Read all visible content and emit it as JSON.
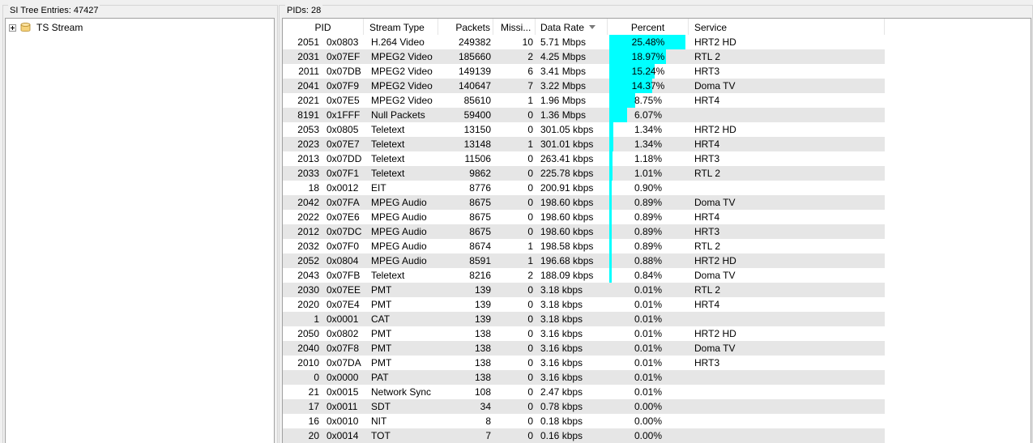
{
  "left_panel": {
    "title": "SI Tree Entries: 47427",
    "tree_root": "TS Stream"
  },
  "right_panel": {
    "title": "PIDs: 28"
  },
  "columns": {
    "pid": "PID",
    "type": "Stream Type",
    "packets": "Packets",
    "missing": "Missi...",
    "rate": "Data Rate",
    "percent": "Percent",
    "service": "Service"
  },
  "colors": {
    "bar": "#00ffff",
    "alt_row": "#e6e6e6"
  },
  "rows": [
    {
      "dec": "2051",
      "hex": "0x0803",
      "type": "H.264 Video",
      "packets": "249382",
      "missing": "10",
      "rate": "5.71 Mbps",
      "percent": "25.48%",
      "pct_value": 25.48,
      "service": "HRT2 HD"
    },
    {
      "dec": "2031",
      "hex": "0x07EF",
      "type": "MPEG2 Video",
      "packets": "185660",
      "missing": "2",
      "rate": "4.25 Mbps",
      "percent": "18.97%",
      "pct_value": 18.97,
      "service": "RTL 2"
    },
    {
      "dec": "2011",
      "hex": "0x07DB",
      "type": "MPEG2 Video",
      "packets": "149139",
      "missing": "6",
      "rate": "3.41 Mbps",
      "percent": "15.24%",
      "pct_value": 15.24,
      "service": "HRT3"
    },
    {
      "dec": "2041",
      "hex": "0x07F9",
      "type": "MPEG2 Video",
      "packets": "140647",
      "missing": "7",
      "rate": "3.22 Mbps",
      "percent": "14.37%",
      "pct_value": 14.37,
      "service": "Doma TV"
    },
    {
      "dec": "2021",
      "hex": "0x07E5",
      "type": "MPEG2 Video",
      "packets": "85610",
      "missing": "1",
      "rate": "1.96 Mbps",
      "percent": "8.75%",
      "pct_value": 8.75,
      "service": "HRT4"
    },
    {
      "dec": "8191",
      "hex": "0x1FFF",
      "type": "Null Packets",
      "packets": "59400",
      "missing": "0",
      "rate": "1.36 Mbps",
      "percent": "6.07%",
      "pct_value": 6.07,
      "service": ""
    },
    {
      "dec": "2053",
      "hex": "0x0805",
      "type": "Teletext",
      "packets": "13150",
      "missing": "0",
      "rate": "301.05 kbps",
      "percent": "1.34%",
      "pct_value": 1.34,
      "service": "HRT2 HD"
    },
    {
      "dec": "2023",
      "hex": "0x07E7",
      "type": "Teletext",
      "packets": "13148",
      "missing": "1",
      "rate": "301.01 kbps",
      "percent": "1.34%",
      "pct_value": 1.34,
      "service": "HRT4"
    },
    {
      "dec": "2013",
      "hex": "0x07DD",
      "type": "Teletext",
      "packets": "11506",
      "missing": "0",
      "rate": "263.41 kbps",
      "percent": "1.18%",
      "pct_value": 1.18,
      "service": "HRT3"
    },
    {
      "dec": "2033",
      "hex": "0x07F1",
      "type": "Teletext",
      "packets": "9862",
      "missing": "0",
      "rate": "225.78 kbps",
      "percent": "1.01%",
      "pct_value": 1.01,
      "service": "RTL 2"
    },
    {
      "dec": "18",
      "hex": "0x0012",
      "type": "EIT",
      "packets": "8776",
      "missing": "0",
      "rate": "200.91 kbps",
      "percent": "0.90%",
      "pct_value": 0.9,
      "service": ""
    },
    {
      "dec": "2042",
      "hex": "0x07FA",
      "type": "MPEG Audio",
      "packets": "8675",
      "missing": "0",
      "rate": "198.60 kbps",
      "percent": "0.89%",
      "pct_value": 0.89,
      "service": "Doma TV"
    },
    {
      "dec": "2022",
      "hex": "0x07E6",
      "type": "MPEG Audio",
      "packets": "8675",
      "missing": "0",
      "rate": "198.60 kbps",
      "percent": "0.89%",
      "pct_value": 0.89,
      "service": "HRT4"
    },
    {
      "dec": "2012",
      "hex": "0x07DC",
      "type": "MPEG Audio",
      "packets": "8675",
      "missing": "0",
      "rate": "198.60 kbps",
      "percent": "0.89%",
      "pct_value": 0.89,
      "service": "HRT3"
    },
    {
      "dec": "2032",
      "hex": "0x07F0",
      "type": "MPEG Audio",
      "packets": "8674",
      "missing": "1",
      "rate": "198.58 kbps",
      "percent": "0.89%",
      "pct_value": 0.89,
      "service": "RTL 2"
    },
    {
      "dec": "2052",
      "hex": "0x0804",
      "type": "MPEG Audio",
      "packets": "8591",
      "missing": "1",
      "rate": "196.68 kbps",
      "percent": "0.88%",
      "pct_value": 0.88,
      "service": "HRT2 HD"
    },
    {
      "dec": "2043",
      "hex": "0x07FB",
      "type": "Teletext",
      "packets": "8216",
      "missing": "2",
      "rate": "188.09 kbps",
      "percent": "0.84%",
      "pct_value": 0.84,
      "service": "Doma TV"
    },
    {
      "dec": "2030",
      "hex": "0x07EE",
      "type": "PMT",
      "packets": "139",
      "missing": "0",
      "rate": "3.18 kbps",
      "percent": "0.01%",
      "pct_value": 0.01,
      "service": "RTL 2"
    },
    {
      "dec": "2020",
      "hex": "0x07E4",
      "type": "PMT",
      "packets": "139",
      "missing": "0",
      "rate": "3.18 kbps",
      "percent": "0.01%",
      "pct_value": 0.01,
      "service": "HRT4"
    },
    {
      "dec": "1",
      "hex": "0x0001",
      "type": "CAT",
      "packets": "139",
      "missing": "0",
      "rate": "3.18 kbps",
      "percent": "0.01%",
      "pct_value": 0.01,
      "service": ""
    },
    {
      "dec": "2050",
      "hex": "0x0802",
      "type": "PMT",
      "packets": "138",
      "missing": "0",
      "rate": "3.16 kbps",
      "percent": "0.01%",
      "pct_value": 0.01,
      "service": "HRT2 HD"
    },
    {
      "dec": "2040",
      "hex": "0x07F8",
      "type": "PMT",
      "packets": "138",
      "missing": "0",
      "rate": "3.16 kbps",
      "percent": "0.01%",
      "pct_value": 0.01,
      "service": "Doma TV"
    },
    {
      "dec": "2010",
      "hex": "0x07DA",
      "type": "PMT",
      "packets": "138",
      "missing": "0",
      "rate": "3.16 kbps",
      "percent": "0.01%",
      "pct_value": 0.01,
      "service": "HRT3"
    },
    {
      "dec": "0",
      "hex": "0x0000",
      "type": "PAT",
      "packets": "138",
      "missing": "0",
      "rate": "3.16 kbps",
      "percent": "0.01%",
      "pct_value": 0.01,
      "service": ""
    },
    {
      "dec": "21",
      "hex": "0x0015",
      "type": "Network Sync",
      "packets": "108",
      "missing": "0",
      "rate": "2.47 kbps",
      "percent": "0.01%",
      "pct_value": 0.01,
      "service": ""
    },
    {
      "dec": "17",
      "hex": "0x0011",
      "type": "SDT",
      "packets": "34",
      "missing": "0",
      "rate": "0.78 kbps",
      "percent": "0.00%",
      "pct_value": 0.0,
      "service": ""
    },
    {
      "dec": "16",
      "hex": "0x0010",
      "type": "NIT",
      "packets": "8",
      "missing": "0",
      "rate": "0.18 kbps",
      "percent": "0.00%",
      "pct_value": 0.0,
      "service": ""
    },
    {
      "dec": "20",
      "hex": "0x0014",
      "type": "TOT",
      "packets": "7",
      "missing": "0",
      "rate": "0.16 kbps",
      "percent": "0.00%",
      "pct_value": 0.0,
      "service": ""
    }
  ]
}
